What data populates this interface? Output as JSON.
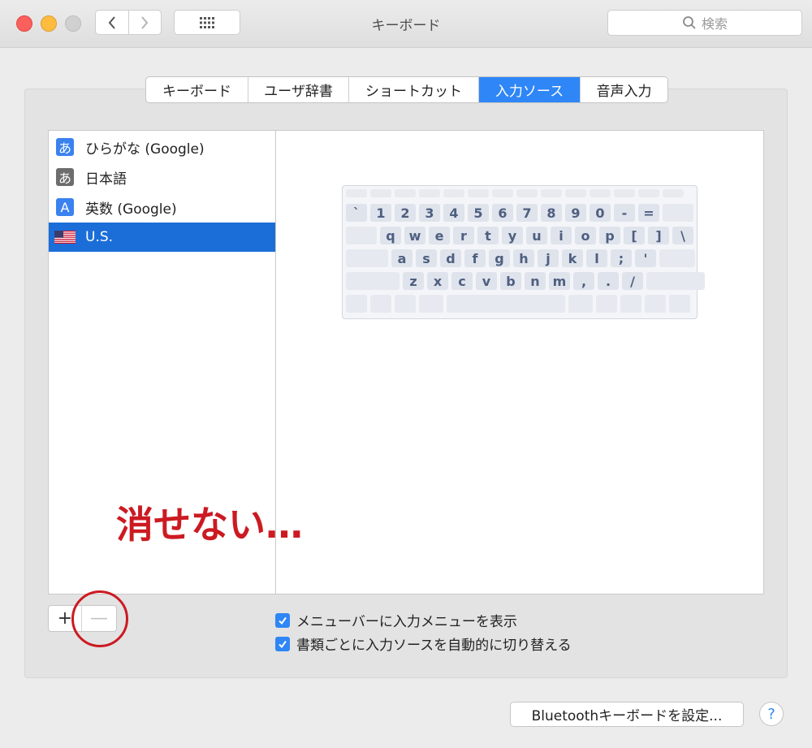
{
  "window": {
    "title": "キーボード",
    "search_placeholder": "検索"
  },
  "tabs": [
    {
      "label": "キーボード",
      "active": false
    },
    {
      "label": "ユーザ辞書",
      "active": false
    },
    {
      "label": "ショートカット",
      "active": false
    },
    {
      "label": "入力ソース",
      "active": true
    },
    {
      "label": "音声入力",
      "active": false
    }
  ],
  "input_sources": [
    {
      "icon_label": "あ",
      "icon": "hiragana-icon",
      "label": "ひらがな (Google)",
      "selected": false
    },
    {
      "icon_label": "あ",
      "icon": "japanese-icon",
      "label": "日本語",
      "selected": false
    },
    {
      "icon_label": "A",
      "icon": "alphanumeric-icon",
      "label": "英数 (Google)",
      "selected": false
    },
    {
      "icon": "us-flag-icon",
      "label": "U.S.",
      "selected": true
    }
  ],
  "keyboard": {
    "row1": [
      "`",
      "1",
      "2",
      "3",
      "4",
      "5",
      "6",
      "7",
      "8",
      "9",
      "0",
      "-",
      "="
    ],
    "row2": [
      "q",
      "w",
      "e",
      "r",
      "t",
      "y",
      "u",
      "i",
      "o",
      "p",
      "[",
      "]",
      "\\"
    ],
    "row3": [
      "a",
      "s",
      "d",
      "f",
      "g",
      "h",
      "j",
      "k",
      "l",
      ";",
      "'"
    ],
    "row4": [
      "z",
      "x",
      "c",
      "v",
      "b",
      "n",
      "m",
      ",",
      ".",
      "/"
    ]
  },
  "annotation": "消せない…",
  "buttons": {
    "add": "+",
    "remove": "—",
    "bluetooth": "Bluetoothキーボードを設定...",
    "help": "?"
  },
  "checkboxes": [
    {
      "label": "メニューバーに入力メニューを表示",
      "checked": true
    },
    {
      "label": "書類ごとに入力ソースを自動的に切り替える",
      "checked": true
    }
  ],
  "colors": {
    "accent": "#2f86f6",
    "selection": "#1b6ed8",
    "annotation": "#cc1a22"
  }
}
